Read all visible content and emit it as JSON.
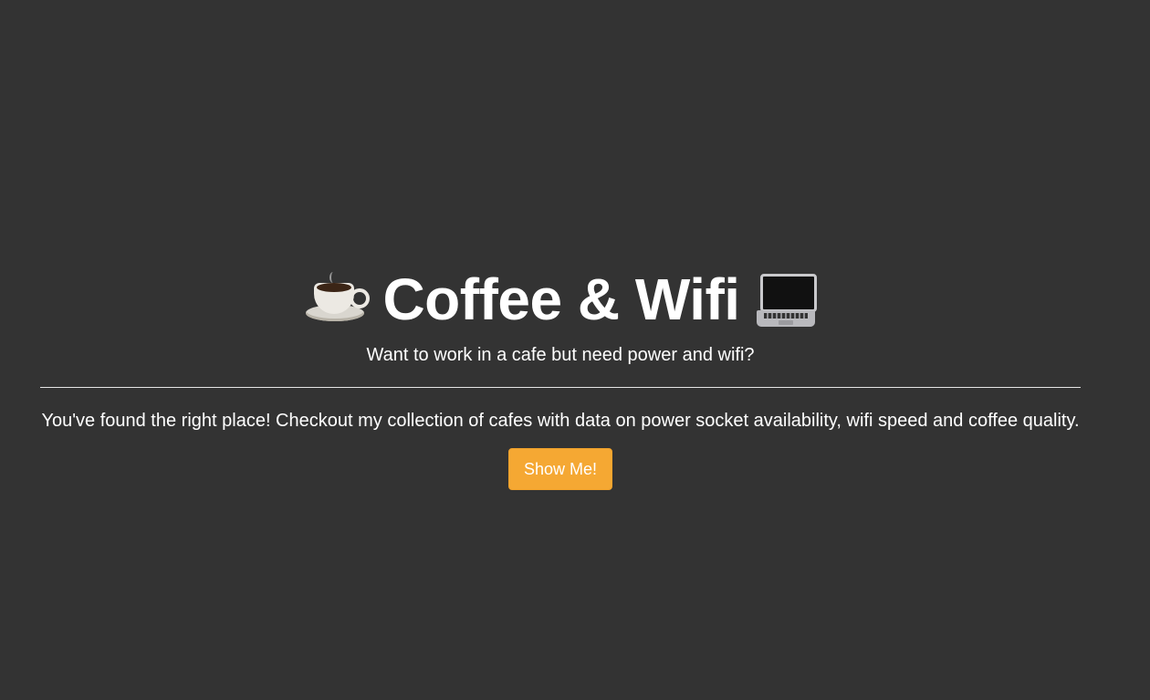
{
  "header": {
    "title": "Coffee & Wifi",
    "left_icon": "coffee-cup-icon",
    "right_icon": "laptop-icon",
    "subtitle": "Want to work in a cafe but need power and wifi?"
  },
  "main": {
    "description": "You've found the right place! Checkout my collection of cafes with data on power socket availability, wifi speed and coffee quality.",
    "cta_label": "Show Me!"
  },
  "colors": {
    "background": "#333333",
    "text": "#ffffff",
    "button": "#f5a833"
  }
}
